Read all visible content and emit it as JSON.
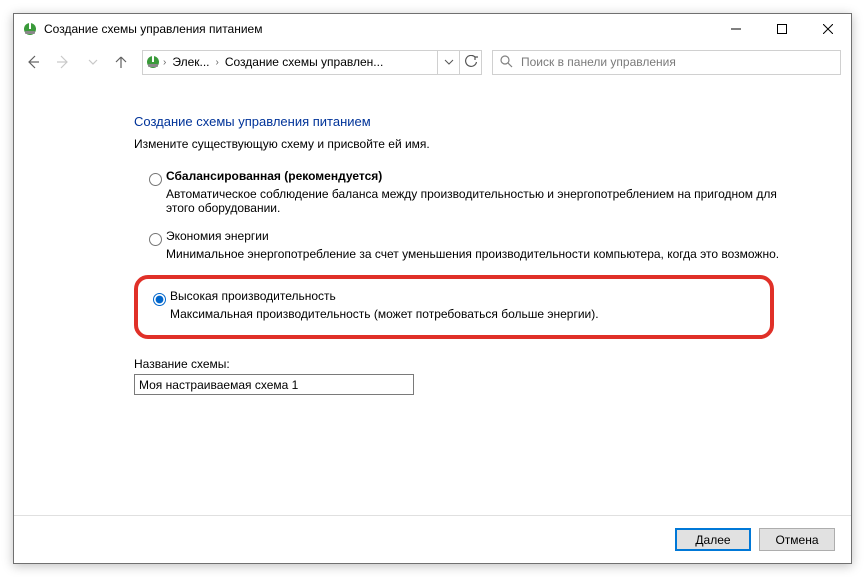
{
  "window": {
    "title": "Создание схемы управления питанием"
  },
  "nav": {
    "crumb1": "Элек...",
    "crumb2": "Создание схемы управлен...",
    "search_placeholder": "Поиск в панели управления"
  },
  "page": {
    "heading": "Создание схемы управления питанием",
    "subtitle": "Измените существующую схему и присвойте ей имя."
  },
  "plans": {
    "balanced": {
      "label": "Сбалансированная (рекомендуется)",
      "desc": "Автоматическое соблюдение баланса между производительностью и энергопотреблением на пригодном для этого оборудовании."
    },
    "saver": {
      "label": "Экономия энергии",
      "desc": "Минимальное энергопотребление за счет уменьшения производительности компьютера, когда это возможно."
    },
    "high": {
      "label": "Высокая производительность",
      "desc": "Максимальная производительность (может потребоваться больше энергии)."
    }
  },
  "scheme": {
    "label": "Название схемы:",
    "value": "Моя настраиваемая схема 1"
  },
  "footer": {
    "next": "Далее",
    "cancel": "Отмена"
  }
}
